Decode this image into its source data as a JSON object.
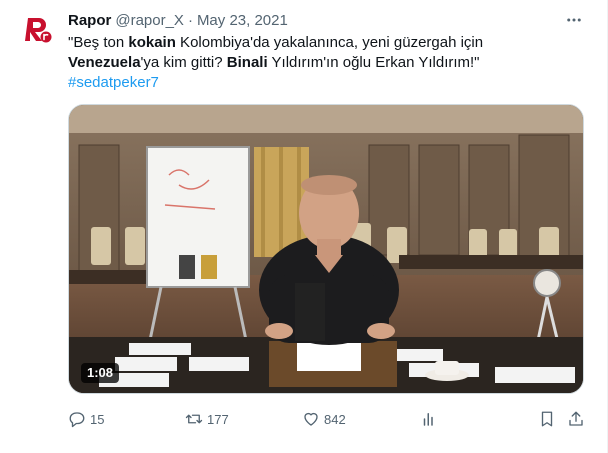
{
  "tweet": {
    "author_name": "Rapor",
    "handle": "@rapor_X",
    "separator": "·",
    "date": "May 23, 2021",
    "text": {
      "p1": "\"Beş ton ",
      "p2": "kokain",
      "p3": " Kolombiya'da yakalanınca, yeni güzergah için ",
      "p4": "Venezuela",
      "p5": "'ya kim gitti? ",
      "p6": "Binali",
      "p7": " Yıldırım'ın oğlu Erkan Yıldırım!\""
    },
    "hashtag": "#sedatpeker7",
    "media": {
      "duration": "1:08"
    },
    "stats": {
      "replies": "15",
      "retweets": "177",
      "likes": "842",
      "views": ""
    }
  },
  "colors": {
    "accent": "#1d9bf0",
    "secondary_text": "#536471",
    "avatar_red": "#c8102e"
  }
}
